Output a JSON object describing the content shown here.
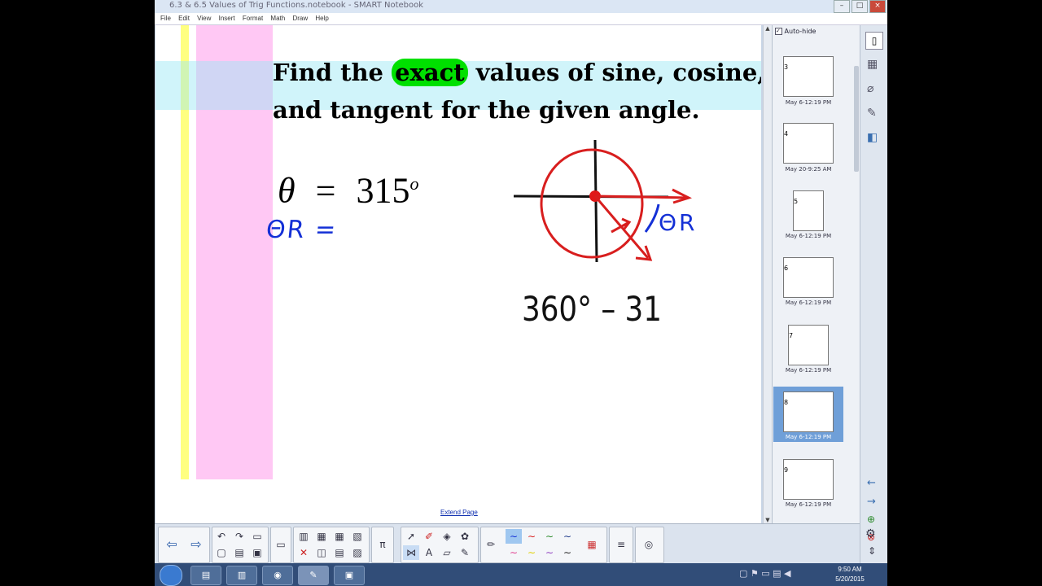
{
  "window": {
    "title": "6.3 & 6.5 Values of Trig Functions.notebook - SMART Notebook",
    "buttons": [
      "–",
      "□",
      "×"
    ]
  },
  "menu": [
    "File",
    "Edit",
    "View",
    "Insert",
    "Format",
    "Math",
    "Draw",
    "Help"
  ],
  "slide": {
    "headline_before": "Find the ",
    "headline_highlight": "exact",
    "headline_after": " values of sine, cosine,",
    "headline_line2": "and tangent for the given angle.",
    "theta_symbol": "θ",
    "equals": "=",
    "angle_value": "315",
    "degree_mark": "o",
    "handwritten_lhs": "ΘR =",
    "handwritten_label": "ΘR",
    "handwritten_calc": "360° – 31",
    "highlight_color": "#00e000"
  },
  "extend_page": "Extend Page",
  "sidebar": {
    "auto_hide_label": "Auto-hide",
    "thumbnails": [
      {
        "num": "3",
        "caption": "May 6-12:19 PM"
      },
      {
        "num": "4",
        "caption": "May 20-9:25 AM"
      },
      {
        "num": "5",
        "caption": "May 6-12:19 PM"
      },
      {
        "num": "6",
        "caption": "May 6-12:19 PM"
      },
      {
        "num": "7",
        "caption": "May 6-12:19 PM"
      },
      {
        "num": "8",
        "caption": "May 6-12:19 PM"
      },
      {
        "num": "9",
        "caption": "May 6-12:19 PM"
      }
    ]
  },
  "taskbar": {
    "time": "9:50 AM",
    "date": "5/20/2015"
  }
}
